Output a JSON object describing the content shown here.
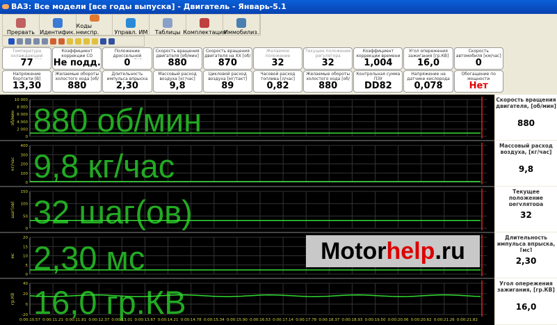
{
  "window": {
    "title": "ВАЗ: Все модели [все годы выпуска] - Двигатель - Январь-5.1"
  },
  "toolbar": [
    {
      "label": "Прервать",
      "icon": "stop-icon",
      "color": "#c06060"
    },
    {
      "label": "Идентифик.",
      "icon": "info-icon",
      "color": "#3a7bd5"
    },
    {
      "label": "Коды неиспр.",
      "icon": "engine-icon",
      "color": "#e07830"
    },
    {
      "label": "Управл. ИМ",
      "icon": "gear-icon",
      "color": "#2b8ad8"
    },
    {
      "label": "Таблицы",
      "icon": "table-icon",
      "color": "#8aa0c8"
    },
    {
      "label": "Комплектация",
      "icon": "checklist-icon",
      "color": "#c04040"
    },
    {
      "label": "Иммобилиз.",
      "icon": "key-icon",
      "color": "#4a7fb0"
    }
  ],
  "playback": [
    "pause-icon",
    "first-icon",
    "prev-icon",
    "next-icon",
    "last-icon",
    "zoom-in-icon",
    "zoom-out-icon",
    "marker-icon",
    "new-icon",
    "open-icon",
    "export-icon",
    "save-icon",
    "chart-icon"
  ],
  "gauges": [
    {
      "label": "Температура охлаждающей жидкости [С]",
      "value": "77",
      "dim": true
    },
    {
      "label": "Коэффициент коррекции CO",
      "value": "Не подд."
    },
    {
      "label": "Положение дроссельной заслонки [%]",
      "value": "0"
    },
    {
      "label": "Скорость вращения двигателя [об/мин]",
      "value": "880"
    },
    {
      "label": "Скорость вращения двигателя на ХХ [об/мин]",
      "value": "870"
    },
    {
      "label": "Желаемое положение регулятора холостого хода [шаг(ов)]",
      "value": "32",
      "dim": true
    },
    {
      "label": "Текущее положение регулятора холостого хода [шаг(ов)]",
      "value": "32",
      "dim": true
    },
    {
      "label": "Коэффициент коррекции времени впрыска",
      "value": "1,004"
    },
    {
      "label": "Угол опережения зажигания [гр.КВ]",
      "value": "16,0"
    },
    {
      "label": "Скорость автомобиля [км/час]",
      "value": "0"
    },
    {
      "label": "",
      "value": ""
    },
    {
      "label": "Напряжение бортсети [В]",
      "value": "13,30"
    },
    {
      "label": "Желаемые обороты холостого хода [об/мин]",
      "value": "880"
    },
    {
      "label": "Длительность импульса впрыска [мс]",
      "value": "2,30"
    },
    {
      "label": "Массовый расход воздуха [кг/час]",
      "value": "9,8"
    },
    {
      "label": "Цикловой расход воздуха [мг/такт]",
      "value": "89"
    },
    {
      "label": "Часовой расход топлива [л/час]",
      "value": "0,82"
    },
    {
      "label": "Желаемые обороты холостого хода [об/мин]",
      "value": "880"
    },
    {
      "label": "Контрольная сумма ПЗУ",
      "value": "DD82"
    },
    {
      "label": "Напряжение на датчике кислорода [В]",
      "value": "0,078"
    },
    {
      "label": "Обогащение по мощности",
      "value": "Нет",
      "color": "#e00000"
    }
  ],
  "chart_data": [
    {
      "type": "line",
      "ylabel": "об/мин",
      "ylim": [
        0,
        10000
      ],
      "yticks": [
        "0",
        "2 000",
        "4 000",
        "6 000",
        "8 000",
        "10 000"
      ],
      "value": 880,
      "big_label": "880 об/мин",
      "panel_label": "Скорость вращения двигателя, [об/мин]",
      "panel_value": "880"
    },
    {
      "type": "line",
      "ylabel": "кг/час",
      "ylim": [
        0,
        400
      ],
      "yticks": [
        "0",
        "100",
        "200",
        "300",
        "400"
      ],
      "value": 9.8,
      "big_label": "9,8 кг/час",
      "panel_label": "Массовый расход воздуха, [кг/час]",
      "panel_value": "9,8"
    },
    {
      "type": "line",
      "ylabel": "шаг(ов)",
      "ylim": [
        0,
        150
      ],
      "yticks": [
        "0",
        "50",
        "100",
        "150"
      ],
      "value": 32,
      "big_label": "32 шаг(ов)",
      "panel_label": "Текущее положение регулятора холостого хода, [шаг(ов)]",
      "panel_value": "32"
    },
    {
      "type": "line",
      "ylabel": "мс",
      "ylim": [
        0,
        20
      ],
      "yticks": [
        "0",
        "5",
        "10",
        "15",
        "20"
      ],
      "value": 2.3,
      "big_label": "2,30 мс",
      "panel_label": "Длительность импульса впрыска, [мс]",
      "panel_value": "2,30"
    },
    {
      "type": "line",
      "ylabel": "гр.КВ",
      "ylim": [
        -20,
        40
      ],
      "yticks": [
        "-20",
        "0",
        "20",
        "40"
      ],
      "value": 16,
      "big_label": "16,0 гр.КВ",
      "panel_label": "Угол опережения зажигания, [гр.КВ]",
      "panel_value": "16,0"
    }
  ],
  "time_axis": [
    "0:00:10.57",
    "0:00:11.21",
    "0:00:11.81",
    "0:00:12.37",
    "0:00:13.01",
    "0:00:13.67",
    "0:00:14.21",
    "0:00:14.78",
    "0:00:15.34",
    "0:00:15.90",
    "0:00:16.53",
    "0:00:17.14",
    "0:00:17.78",
    "0:00:18.37",
    "0:00:18.93",
    "0:00:19.50",
    "0:00:20.06",
    "0:00:20.62",
    "0:00:21.26",
    "0:00:21.82"
  ],
  "colors": {
    "line": "#33dd33",
    "big_text": "#22aa22",
    "cursor": "#dd2222",
    "axis_text": "#d8d840"
  },
  "watermark": {
    "a": "Motor",
    "b": "help",
    "c": ".ru"
  }
}
